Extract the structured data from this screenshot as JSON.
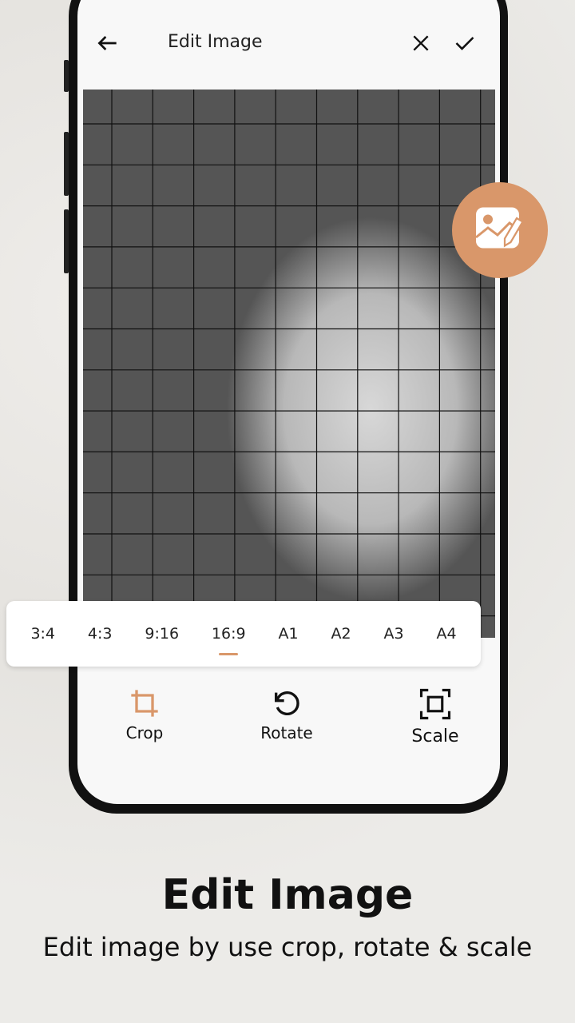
{
  "header": {
    "title": "Edit Image",
    "back_icon": "arrow-left-icon",
    "close_icon": "close-icon",
    "confirm_icon": "check-icon"
  },
  "ratios": {
    "items": [
      "3:4",
      "4:3",
      "9:16",
      "16:9",
      "A1",
      "A2",
      "A3",
      "A4"
    ],
    "selected": "16:9"
  },
  "tools": [
    {
      "label": "Crop",
      "icon": "crop-icon",
      "active": true
    },
    {
      "label": "Rotate",
      "icon": "rotate-ccw-icon"
    },
    {
      "label": "Scale",
      "icon": "scale-frame-icon"
    }
  ],
  "fab_icon": "image-edit-icon",
  "promo": {
    "title": "Edit Image",
    "subtitle": "Edit image by use crop, rotate & scale"
  },
  "colors": {
    "accent": "#D9976A"
  }
}
